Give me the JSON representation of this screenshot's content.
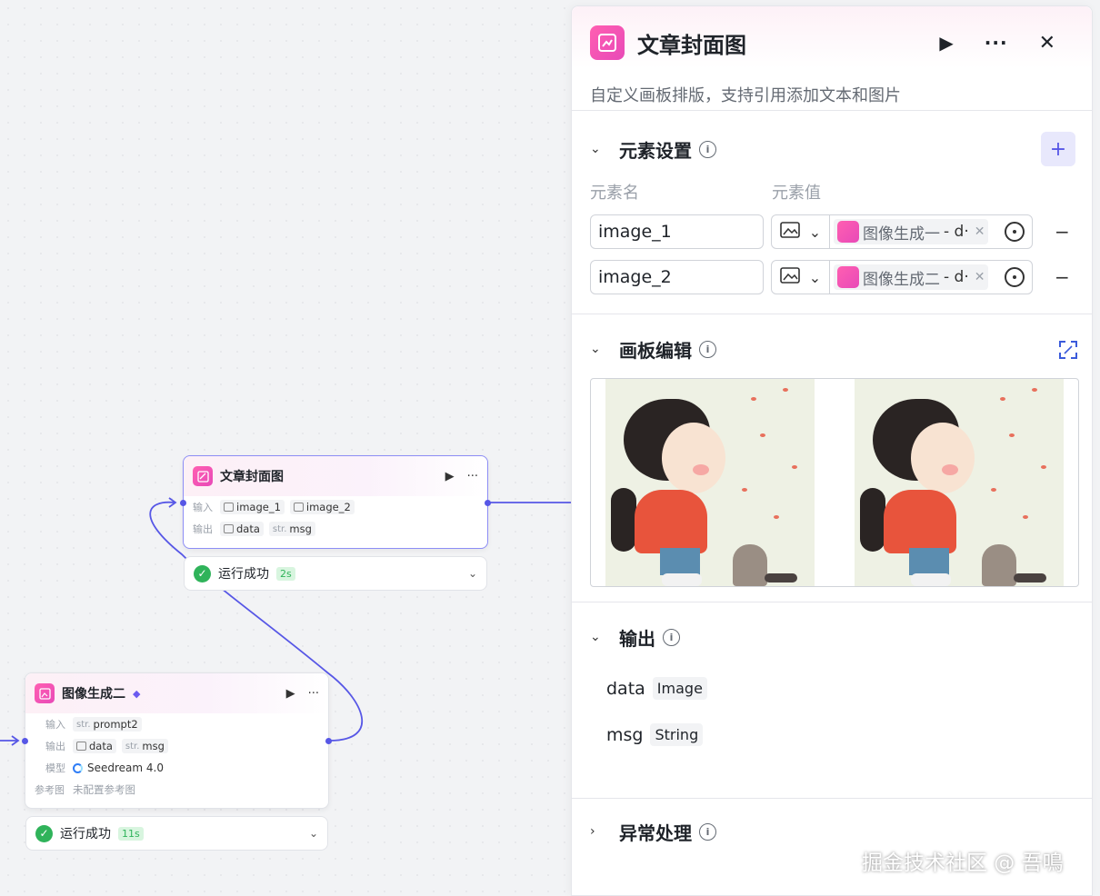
{
  "panel": {
    "title": "文章封面图",
    "description": "自定义画板排版，支持引用添加文本和图片",
    "play_icon": "▶",
    "more_icon": "···",
    "close_icon": "✕",
    "elements": {
      "title": "元素设置",
      "col_name": "元素名",
      "col_value": "元素值",
      "add": "+",
      "rows": [
        {
          "name": "image_1",
          "source": "图像生成一",
          "ref": "- d·",
          "remove": "−"
        },
        {
          "name": "image_2",
          "source": "图像生成二",
          "ref": "- d·",
          "remove": "−"
        }
      ]
    },
    "canvas_edit": {
      "title": "画板编辑"
    },
    "output": {
      "title": "输出",
      "items": [
        {
          "name": "data",
          "type": "Image"
        },
        {
          "name": "msg",
          "type": "String"
        }
      ]
    },
    "exception": {
      "title": "异常处理"
    }
  },
  "node_cover": {
    "title": "文章封面图",
    "play": "▶",
    "more": "···",
    "input_label": "输入",
    "output_label": "输出",
    "inputs": [
      "image_1",
      "image_2"
    ],
    "outputs": [
      {
        "type": "",
        "name": "data"
      },
      {
        "type": "str.",
        "name": "msg"
      }
    ],
    "status": "运行成功",
    "duration": "2s"
  },
  "node_gen2": {
    "title": "图像生成二",
    "play": "▶",
    "more": "···",
    "input_label": "输入",
    "output_label": "输出",
    "model_label": "模型",
    "ref_label": "参考图",
    "input_type": "str.",
    "input_name": "prompt2",
    "outputs": [
      {
        "type": "",
        "name": "data"
      },
      {
        "type": "str.",
        "name": "msg"
      }
    ],
    "model": "Seedream 4.0",
    "ref_value": "未配置参考图",
    "status": "运行成功",
    "duration": "11s"
  },
  "watermark": "掘金技术社区 @ 吾鳴",
  "colors": {
    "accent": "#5757e6",
    "brand_pink": "#e84ab8",
    "success": "#2fb35a"
  }
}
